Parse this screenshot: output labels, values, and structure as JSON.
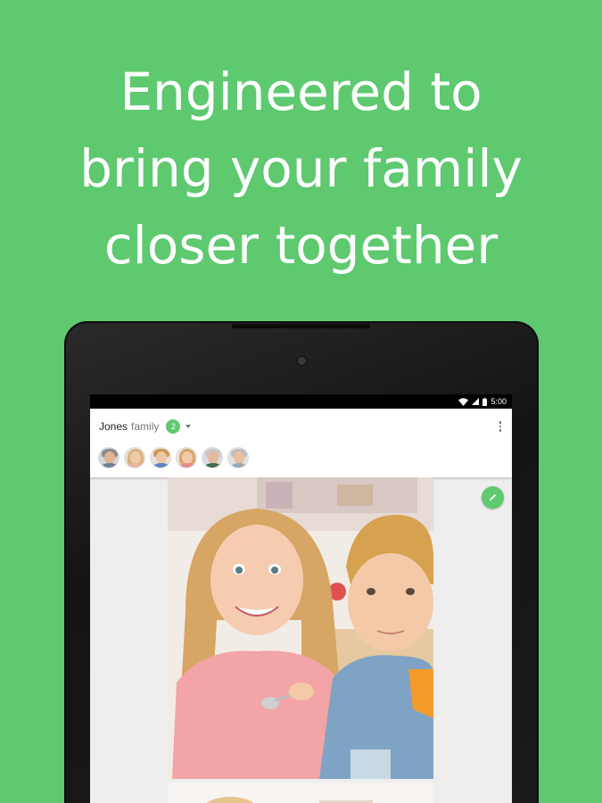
{
  "headline": {
    "line1": "Engineered to",
    "line2": "bring your family",
    "line3": "closer together"
  },
  "statusbar": {
    "time": "5:00",
    "icons": [
      "wifi-icon",
      "signal-icon",
      "battery-icon"
    ]
  },
  "appbar": {
    "group_name": "Jones",
    "group_suffix": "family",
    "badge_count": "2",
    "menu_icon": "overflow-menu-icon"
  },
  "members": [
    {
      "name": "member-1"
    },
    {
      "name": "member-2"
    },
    {
      "name": "member-3"
    },
    {
      "name": "member-4"
    },
    {
      "name": "member-5"
    },
    {
      "name": "member-6"
    }
  ],
  "fab": {
    "icon": "pencil-icon"
  },
  "colors": {
    "background": "#5ec96f",
    "accent": "#5ec96f",
    "text_primary": "#222222",
    "text_secondary": "#777777"
  }
}
